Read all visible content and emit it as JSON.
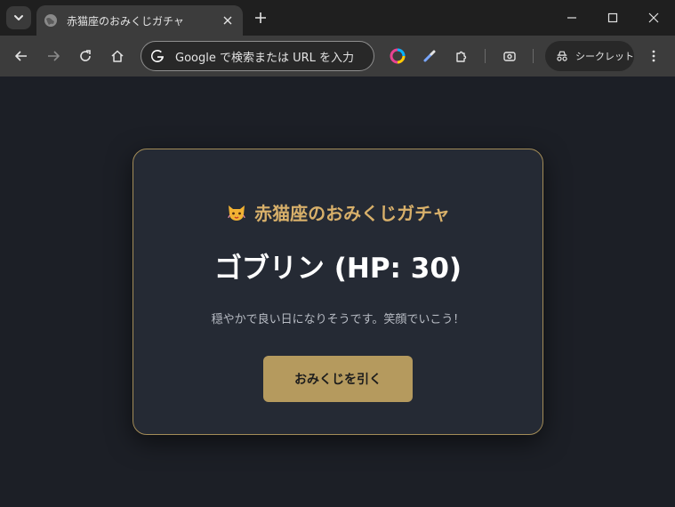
{
  "browser": {
    "tab": {
      "title": "赤猫座のおみくじガチャ"
    },
    "omnibox": {
      "placeholder": "Google で検索または URL を入力"
    },
    "incognito": {
      "label": "シークレット"
    }
  },
  "page": {
    "title": "赤猫座のおみくじガチャ",
    "result": "ゴブリン (HP: 30)",
    "message": "穏やかで良い日になりそうです。笑顔でいこう！",
    "draw_button_label": "おみくじを引く"
  },
  "colors": {
    "accent_gold": "#d8b06a",
    "button_bg": "#b59a5e",
    "card_bg": "#252a34",
    "page_bg": "#1c1f26"
  }
}
